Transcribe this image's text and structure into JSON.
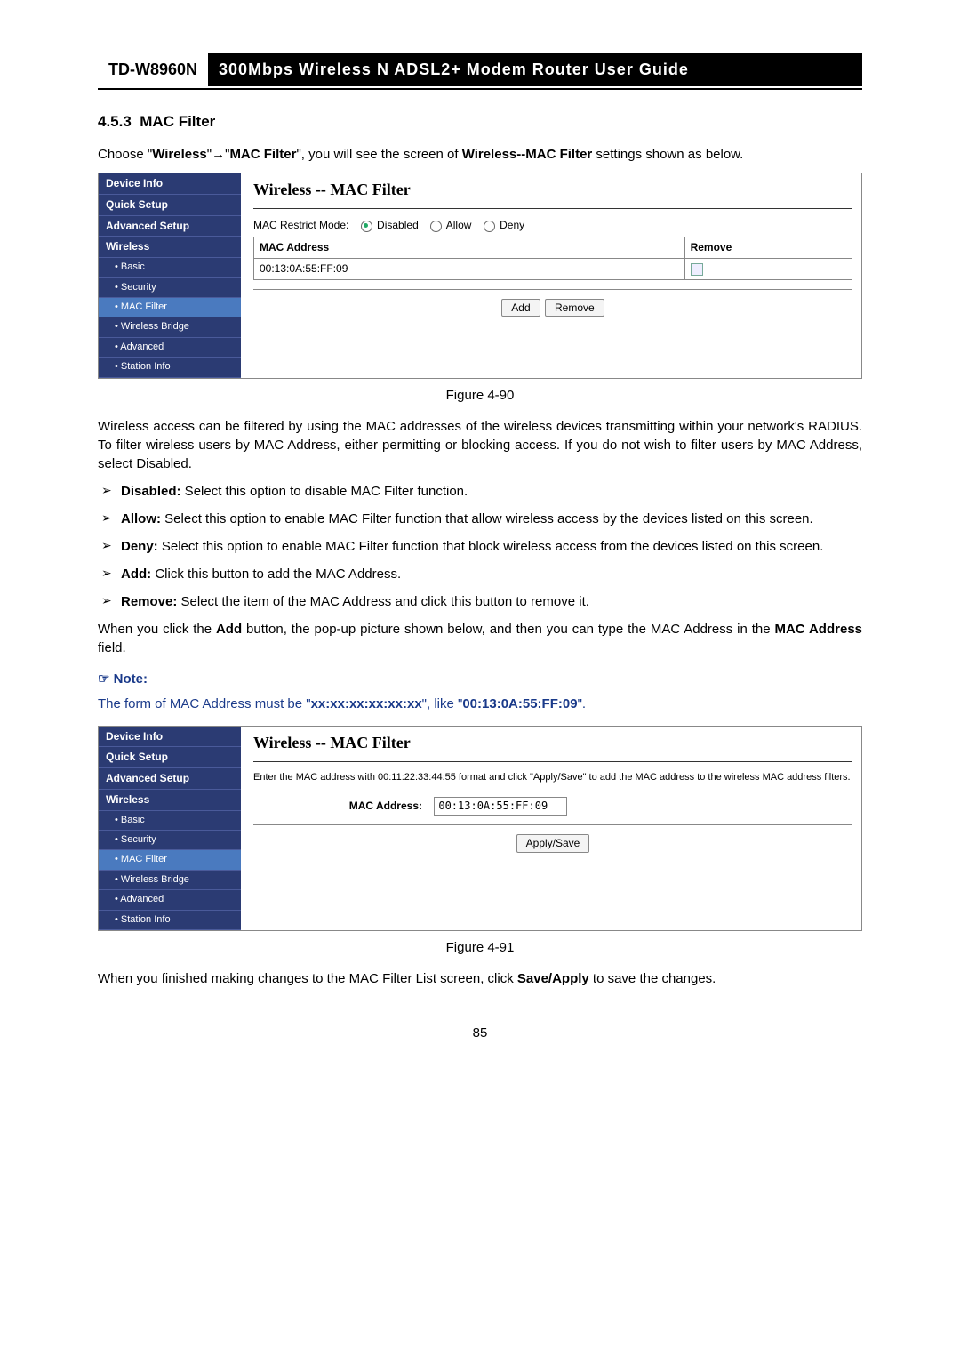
{
  "header": {
    "model": "TD-W8960N",
    "title": "300Mbps Wireless N ADSL2+ Modem Router User Guide"
  },
  "section": {
    "number": "4.5.3",
    "name": "MAC Filter"
  },
  "intro": {
    "p1a": "Choose \"",
    "p1b": "Wireless",
    "p1c": "\"→\"",
    "p1d": "MAC Filter",
    "p1e": "\", you will see the screen of ",
    "p1f": "Wireless--MAC Filter",
    "p1g": " settings shown as below."
  },
  "nav": {
    "items": [
      {
        "label": "Device Info",
        "bold": true
      },
      {
        "label": "Quick Setup",
        "bold": true
      },
      {
        "label": "Advanced Setup",
        "bold": true
      },
      {
        "label": "Wireless",
        "bold": true
      },
      {
        "label": "• Basic",
        "sub": true
      },
      {
        "label": "• Security",
        "sub": true
      },
      {
        "label": "• MAC Filter",
        "sub": true,
        "active": true
      },
      {
        "label": "• Wireless Bridge",
        "sub": true
      },
      {
        "label": "• Advanced",
        "sub": true
      },
      {
        "label": "• Station Info",
        "sub": true
      }
    ]
  },
  "fig90": {
    "title": "Wireless -- MAC Filter",
    "restrict_label": "MAC Restrict Mode:",
    "opts": {
      "disabled": "Disabled",
      "allow": "Allow",
      "deny": "Deny"
    },
    "th_mac": "MAC Address",
    "th_remove": "Remove",
    "row_mac": "00:13:0A:55:FF:09",
    "btn_add": "Add",
    "btn_remove": "Remove",
    "caption": "Figure 4-90"
  },
  "body": {
    "p1": "Wireless access can be filtered by using the MAC addresses of the wireless devices transmitting within your network's RADIUS. To filter wireless users by MAC Address, either permitting or blocking access. If you do not wish to filter users by MAC Address, select Disabled.",
    "bullets": [
      {
        "b": "Disabled:",
        "t": " Select this option to disable MAC Filter function."
      },
      {
        "b": "Allow:",
        "t": " Select this option to enable MAC Filter function that allow wireless access by the devices listed on this screen."
      },
      {
        "b": "Deny:",
        "t": " Select this option to enable MAC Filter function that block wireless access from the devices listed on this screen."
      },
      {
        "b": "Add:",
        "t": " Click this button to add the MAC Address."
      },
      {
        "b": "Remove:",
        "t": " Select the item of the MAC Address and click this button to remove it."
      }
    ],
    "p2a": "When you click the ",
    "p2b": "Add",
    "p2c": " button, the pop-up picture shown below, and then you can type the MAC Address in the ",
    "p2d": "MAC Address",
    "p2e": " field."
  },
  "note": {
    "head": "Note:",
    "a": "The form of MAC Address must be \"",
    "b": "xx:xx:xx:xx:xx:xx",
    "c": "\", like \"",
    "d": "00:13:0A:55:FF:09",
    "e": "\"."
  },
  "fig91": {
    "title": "Wireless -- MAC Filter",
    "instr": "Enter the MAC address with 00:11:22:33:44:55 format and click \"Apply/Save\" to add the MAC address to the wireless MAC address filters.",
    "mac_label": "MAC Address:",
    "mac_value": "00:13:0A:55:FF:09",
    "btn": "Apply/Save",
    "caption": "Figure 4-91"
  },
  "closing": {
    "a": "When you finished making changes to the MAC Filter List screen, click ",
    "b": "Save/Apply",
    "c": " to save the changes."
  },
  "page_number": "85"
}
